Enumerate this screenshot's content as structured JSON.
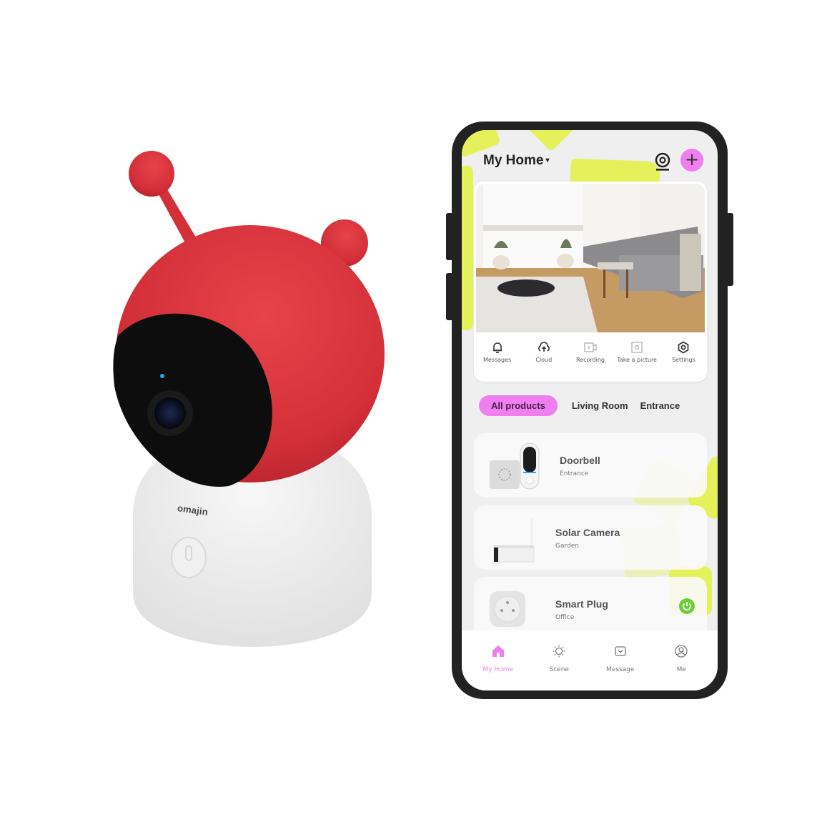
{
  "product": {
    "brand": "omajin",
    "colors": {
      "shell": "#d9303a",
      "body": "#eeeeee",
      "lens": "#111111"
    }
  },
  "app": {
    "header": {
      "title": "My Home",
      "caret": "▾"
    },
    "accent": "#f07ef0",
    "highlight": "#e4f15a",
    "camera_actions": [
      {
        "label": "Messages",
        "icon": "bell-icon"
      },
      {
        "label": "Cloud",
        "icon": "cloud-upload-icon"
      },
      {
        "label": "Recording",
        "icon": "video-recording-icon"
      },
      {
        "label": "Take a picture",
        "icon": "camera-snapshot-icon"
      },
      {
        "label": "Settings",
        "icon": "settings-hexagon-icon"
      }
    ],
    "tabs": [
      {
        "label": "All products",
        "active": true
      },
      {
        "label": "Living Room",
        "active": false
      },
      {
        "label": "Entrance",
        "active": false
      }
    ],
    "devices": [
      {
        "name": "Doorbell",
        "room": "Entrance"
      },
      {
        "name": "Solar Camera",
        "room": "Garden"
      },
      {
        "name": "Smart Plug",
        "room": "Office",
        "power": "on",
        "power_color": "#6ccf3a"
      }
    ],
    "bottom_nav": [
      {
        "label": "My Home",
        "active": true
      },
      {
        "label": "Scene",
        "active": false
      },
      {
        "label": "Message",
        "active": false
      },
      {
        "label": "Me",
        "active": false
      }
    ]
  }
}
